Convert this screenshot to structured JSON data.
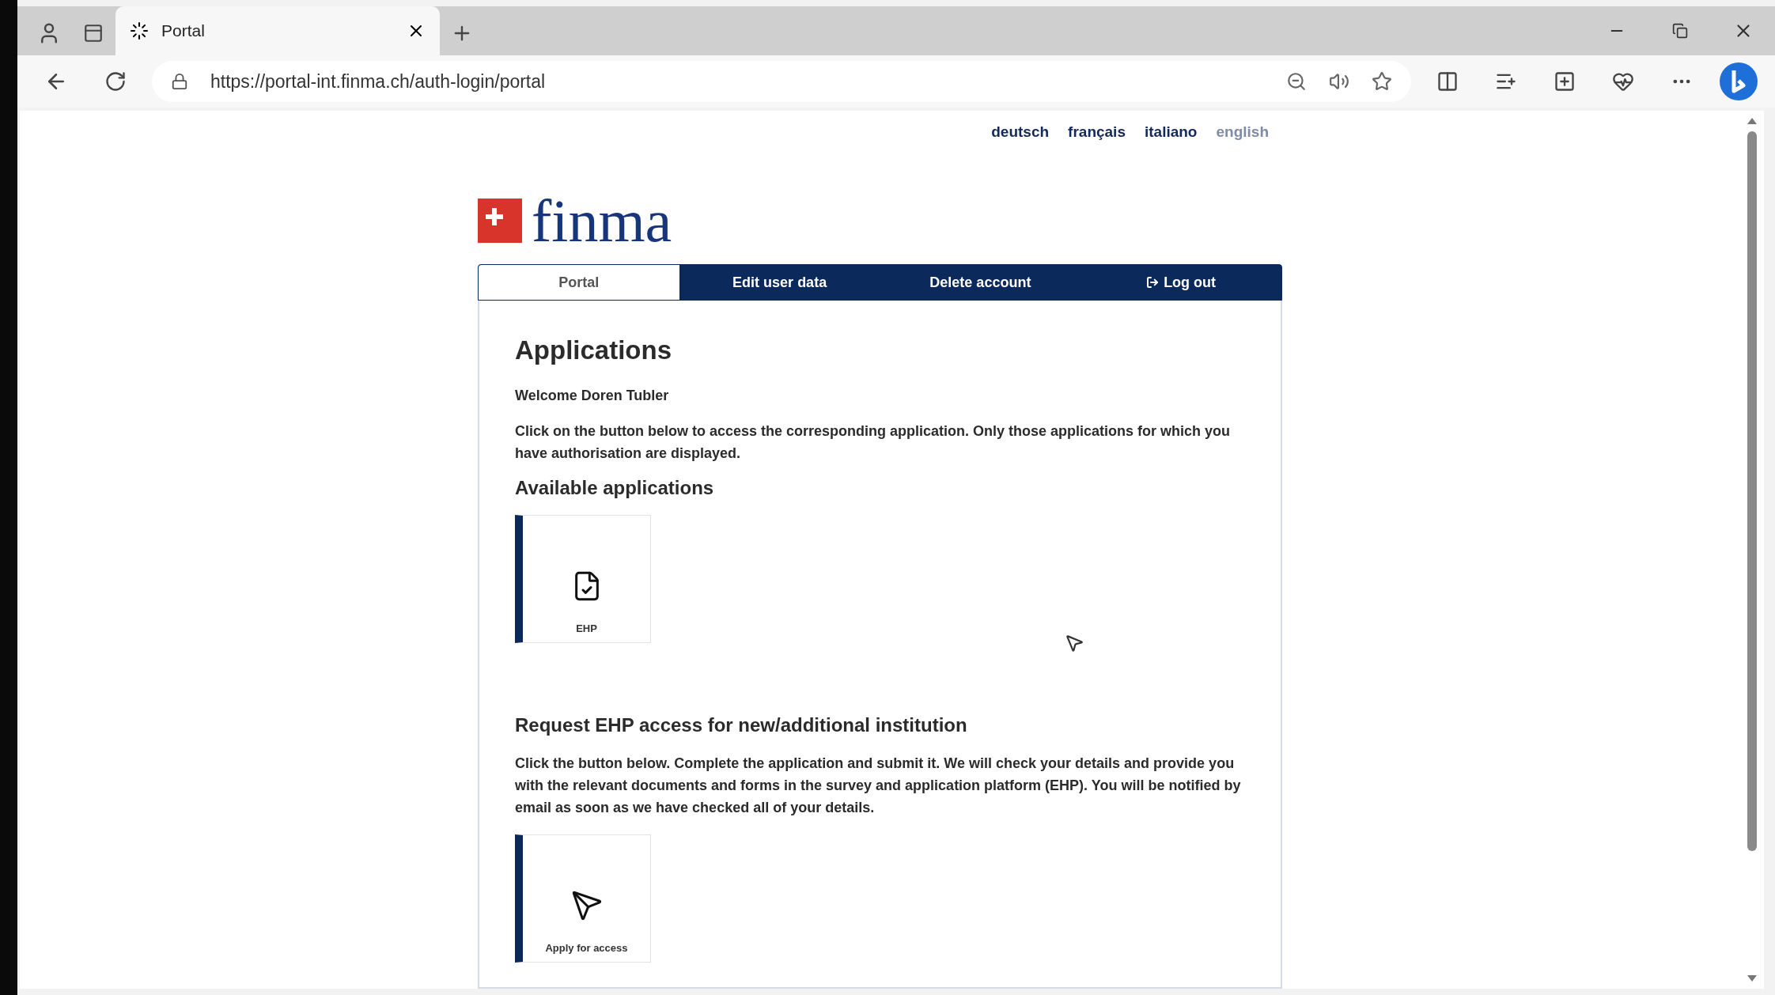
{
  "browser": {
    "tab_title": "Portal",
    "url": "https://portal-int.finma.ch/auth-login/portal"
  },
  "languages": [
    {
      "label": "deutsch",
      "selected": false
    },
    {
      "label": "français",
      "selected": false
    },
    {
      "label": "italiano",
      "selected": false
    },
    {
      "label": "english",
      "selected": true
    }
  ],
  "logo": {
    "text": "finma"
  },
  "tabs": [
    {
      "label": "Portal",
      "selected": true,
      "kind": "plain"
    },
    {
      "label": "Edit user data",
      "selected": false,
      "kind": "plain"
    },
    {
      "label": "Delete account",
      "selected": false,
      "kind": "plain"
    },
    {
      "label": "Log out",
      "selected": false,
      "kind": "logout"
    }
  ],
  "heading": "Applications",
  "welcome": "Welcome Doren Tubler",
  "intro": "Click on the button below to access the corresponding application. Only those applications for which you have authorisation are displayed.",
  "available": {
    "title": "Available applications",
    "cards": [
      {
        "label": "EHP",
        "kind": "document"
      }
    ]
  },
  "request": {
    "title": "Request EHP access for new/additional institution",
    "text": "Click the button below. Complete the application and submit it. We will check your details and provide you with the relevant documents and forms in the survey and application platform (EHP). You will be notified by email as soon as we have checked all of your details.",
    "cards": [
      {
        "label": "Apply for access",
        "kind": "send"
      }
    ]
  }
}
